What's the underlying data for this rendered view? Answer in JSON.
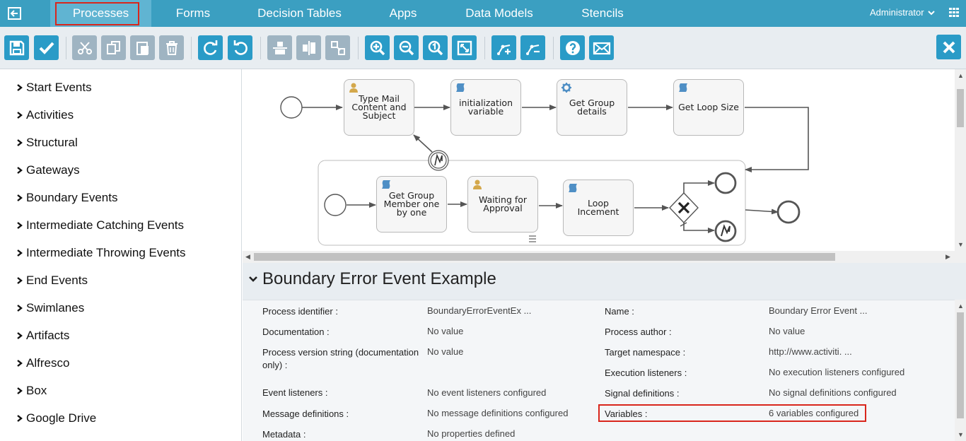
{
  "nav": {
    "tabs": [
      {
        "label": "Processes",
        "active": true
      },
      {
        "label": "Forms"
      },
      {
        "label": "Decision Tables"
      },
      {
        "label": "Apps"
      },
      {
        "label": "Data Models"
      },
      {
        "label": "Stencils"
      }
    ],
    "user": "Administrator"
  },
  "palette": {
    "items": [
      {
        "label": "Start Events"
      },
      {
        "label": "Activities"
      },
      {
        "label": "Structural"
      },
      {
        "label": "Gateways"
      },
      {
        "label": "Boundary Events"
      },
      {
        "label": "Intermediate Catching Events"
      },
      {
        "label": "Intermediate Throwing Events"
      },
      {
        "label": "End Events"
      },
      {
        "label": "Swimlanes"
      },
      {
        "label": "Artifacts"
      },
      {
        "label": "Alfresco"
      },
      {
        "label": "Box"
      },
      {
        "label": "Google Drive"
      }
    ]
  },
  "diagram": {
    "tasks": [
      {
        "label": "Type Mail Content and Subject",
        "icon": "user-icon"
      },
      {
        "label": "initialization variable",
        "icon": "script-icon"
      },
      {
        "label": "Get Group details",
        "icon": "service-icon"
      },
      {
        "label": "Get Loop Size",
        "icon": "script-icon"
      },
      {
        "label": "Get Group Member one by one",
        "icon": "script-icon"
      },
      {
        "label": "Waiting for Approval",
        "icon": "user-icon"
      },
      {
        "label": "Loop Incement",
        "icon": "script-icon"
      }
    ]
  },
  "properties": {
    "title": "Boundary Error Event Example",
    "left": [
      {
        "label": "Process identifier :",
        "value": "BoundaryErrorEventEx ..."
      },
      {
        "label": "Documentation :",
        "value": "No value"
      },
      {
        "label": "Process version string (documentation only) :",
        "value": "No value"
      },
      {
        "label": "Event listeners :",
        "value": "No event listeners configured"
      },
      {
        "label": "Message definitions :",
        "value": "No message definitions configured"
      },
      {
        "label": "Metadata :",
        "value": "No properties defined"
      }
    ],
    "right": [
      {
        "label": "Name :",
        "value": "Boundary Error Event ..."
      },
      {
        "label": "Process author :",
        "value": "No value"
      },
      {
        "label": "Target namespace :",
        "value": "http://www.activiti. ..."
      },
      {
        "label": "Execution listeners :",
        "value": "No execution listeners configured"
      },
      {
        "label": "Signal definitions :",
        "value": "No signal definitions configured"
      },
      {
        "label": "Variables :",
        "value": "6 variables configured"
      }
    ]
  },
  "colors": {
    "nav": "#3b9fc1",
    "button": "#2a9bc7",
    "highlight": "#d9261c"
  }
}
